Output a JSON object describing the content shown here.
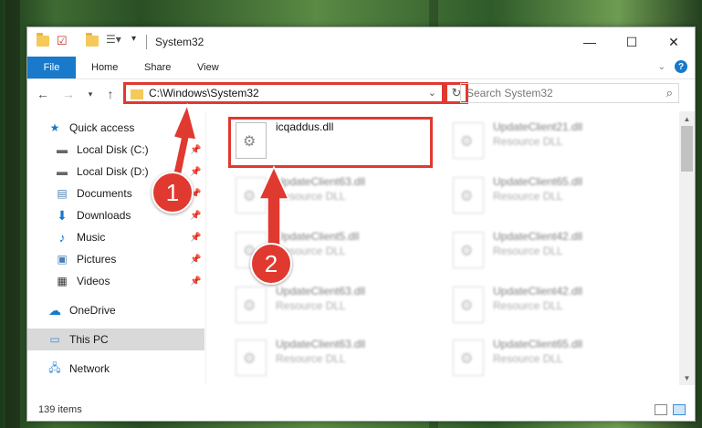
{
  "window": {
    "title": "System32"
  },
  "titlebar": {
    "minimize": "—",
    "maximize": "☐",
    "close": "✕"
  },
  "ribbon": {
    "tabs": [
      "File",
      "Home",
      "Share",
      "View"
    ],
    "help": "?"
  },
  "address": {
    "path": "C:\\Windows\\System32",
    "search_placeholder": "Search System32"
  },
  "sidebar": {
    "items": [
      {
        "label": "Quick access",
        "icon": "star-icon"
      },
      {
        "label": "Local Disk (C:)",
        "icon": "drive-icon"
      },
      {
        "label": "Local Disk (D:)",
        "icon": "drive-icon"
      },
      {
        "label": "Documents",
        "icon": "documents-icon"
      },
      {
        "label": "Downloads",
        "icon": "download-icon"
      },
      {
        "label": "Music",
        "icon": "music-icon"
      },
      {
        "label": "Pictures",
        "icon": "pictures-icon"
      },
      {
        "label": "Videos",
        "icon": "videos-icon"
      },
      {
        "label": "OneDrive",
        "icon": "cloud-icon"
      },
      {
        "label": "This PC",
        "icon": "computer-icon"
      },
      {
        "label": "Network",
        "icon": "network-icon"
      }
    ]
  },
  "files": [
    {
      "name": "icqaddus.dll",
      "type": ""
    },
    {
      "name": "UpdateClient21.dll",
      "type": "Resource DLL"
    },
    {
      "name": "UpdateClient63.dll",
      "type": "Resource DLL"
    },
    {
      "name": "UpdateClient65.dll",
      "type": "Resource DLL"
    },
    {
      "name": "UpdateClient5.dll",
      "type": "Resource DLL"
    },
    {
      "name": "UpdateClient42.dll",
      "type": "Resource DLL"
    },
    {
      "name": "UpdateClient63.dll",
      "type": "Resource DLL"
    },
    {
      "name": "UpdateClient42.dll",
      "type": "Resource DLL"
    },
    {
      "name": "UpdateClient63.dll",
      "type": "Resource DLL"
    },
    {
      "name": "UpdateClient65.dll",
      "type": "Resource DLL"
    }
  ],
  "status": {
    "count": "139 items"
  },
  "callouts": {
    "one": "1",
    "two": "2"
  },
  "colors": {
    "accent": "#1979ca",
    "highlight": "#e0392f"
  }
}
